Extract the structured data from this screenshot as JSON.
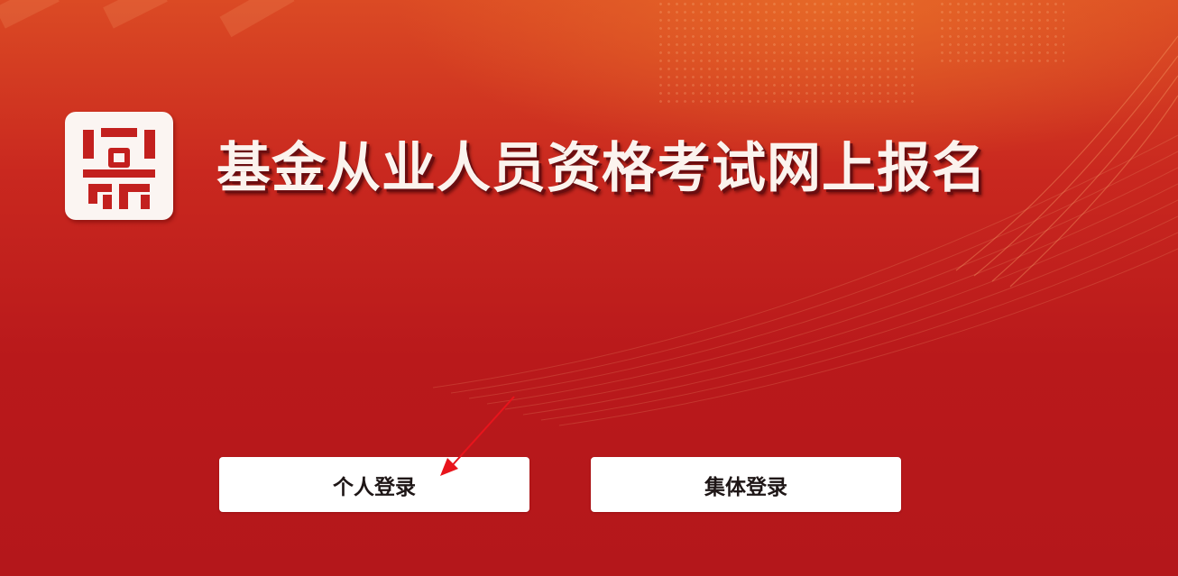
{
  "header": {
    "site_title": "基金从业人员资格考试网上报名",
    "emblem_icon": "seal-logo-icon"
  },
  "login": {
    "personal_label": "个人登录",
    "group_label": "集体登录"
  },
  "annotation": {
    "arrow_icon": "red-arrow-icon",
    "arrow_color": "#e8141c"
  },
  "theme": {
    "background_top": "#db4a24",
    "background_bottom": "#b4171b",
    "button_background": "#ffffff",
    "title_color": "#fbf3ee"
  }
}
